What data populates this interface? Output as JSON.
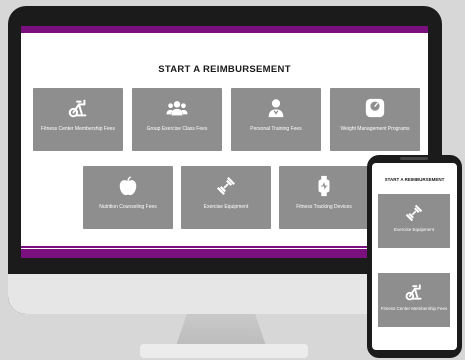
{
  "desktop": {
    "title": "START A REIMBURSEMENT",
    "tiles": [
      {
        "label": "Fitness Center Membership Fees",
        "icon": "exercise-bike-icon"
      },
      {
        "label": "Group Exercise Class Fees",
        "icon": "group-icon"
      },
      {
        "label": "Personal Training Fees",
        "icon": "trainer-icon"
      },
      {
        "label": "Weight Management Programs",
        "icon": "scale-icon"
      },
      {
        "label": "Nutrition Counseling Fees",
        "icon": "apple-icon"
      },
      {
        "label": "Exercise Equipment",
        "icon": "dumbbell-icon"
      },
      {
        "label": "Fitness Tracking Devices",
        "icon": "smartwatch-icon"
      }
    ]
  },
  "mobile": {
    "title": "START A REIMBURSEMENT",
    "tiles": [
      {
        "label": "Exercise Equipment",
        "icon": "dumbbell-icon"
      },
      {
        "label": "Fitness Center Membership Fees",
        "icon": "exercise-bike-icon"
      }
    ]
  },
  "colors": {
    "accent": "#7a0f7e",
    "tile": "#8e8e8e"
  }
}
